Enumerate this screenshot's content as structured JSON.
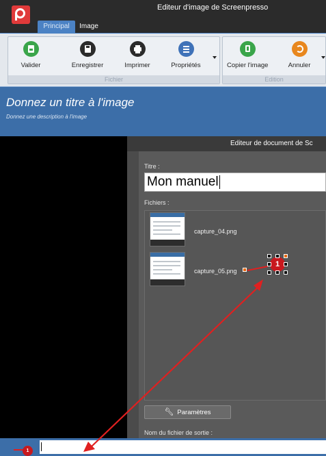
{
  "window": {
    "title": "Editeur d'image de Screenpresso"
  },
  "tabs": [
    {
      "label": "Principal",
      "active": true
    },
    {
      "label": "Image",
      "active": false
    }
  ],
  "ribbon": {
    "groups": [
      {
        "label": "Fichier",
        "buttons": [
          {
            "label": "Valider",
            "icon": "save-check-icon",
            "color": "#3aa54a"
          },
          {
            "label": "Enregistrer",
            "icon": "save-icon",
            "color": "#2b2b2b"
          },
          {
            "label": "Imprimer",
            "icon": "printer-icon",
            "color": "#2b2b2b"
          },
          {
            "label": "Propriétés",
            "icon": "list-icon",
            "color": "#3f72b8"
          }
        ]
      },
      {
        "label": "Edition",
        "buttons": [
          {
            "label": "Copier l'image",
            "icon": "copy-icon",
            "color": "#3aa54a"
          },
          {
            "label": "Annuler",
            "icon": "undo-icon",
            "color": "#e8871e"
          }
        ]
      }
    ]
  },
  "image": {
    "title": "Donnez un titre à l'image",
    "description": "Donnez une description à l'image"
  },
  "dialog": {
    "title": "Editeur de document de Sc",
    "title_label": "Titre :",
    "title_value": "Mon manuel",
    "files_label": "Fichiers :",
    "files": [
      {
        "name": "capture_04.png"
      },
      {
        "name": "capture_05.png"
      }
    ],
    "params_button": "Paramètres",
    "output_label": "Nom du fichier de sortie :"
  },
  "annotation": {
    "number": "1"
  },
  "bottom": {
    "badge": "1"
  },
  "colors": {
    "accent": "#3c6ea8",
    "annotation": "#e02020",
    "badge": "#c8191e"
  }
}
